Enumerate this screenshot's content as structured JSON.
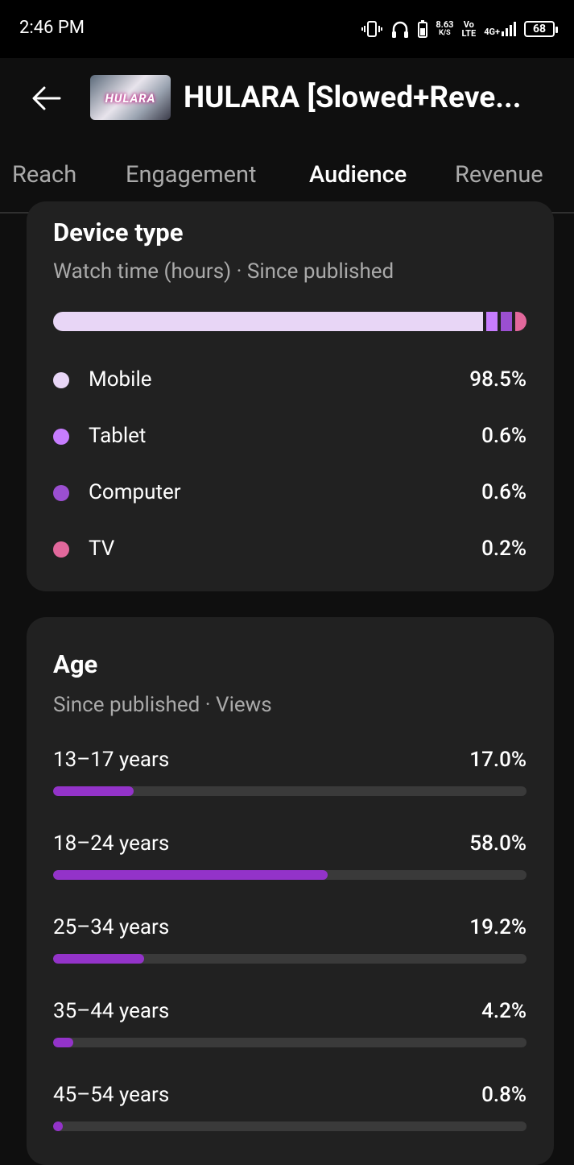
{
  "status_bar": {
    "time": "2:46 PM",
    "net_speed_value": "8.63",
    "net_speed_unit": "K/S",
    "volte_top": "Vo",
    "volte_bottom": "LTE",
    "network": "4G+",
    "battery": "68",
    "icons": [
      "vibrate-icon",
      "headphones-icon",
      "battery-saver-icon",
      "signal-icon",
      "battery-icon"
    ]
  },
  "app_bar": {
    "back_icon": "arrow-left-icon",
    "thumbnail_text": "HULARA",
    "title": "HULARA [Slowed+Reve..."
  },
  "tabs": [
    {
      "label": "Reach",
      "active": false
    },
    {
      "label": "Engagement",
      "active": false
    },
    {
      "label": "Audience",
      "active": true
    },
    {
      "label": "Revenue",
      "active": false
    }
  ],
  "device_type": {
    "title": "Device type",
    "subtitle": "Watch time (hours) · Since published",
    "items": [
      {
        "label": "Mobile",
        "value": "98.5%",
        "percent": 98.5,
        "color": "#e8d6f6"
      },
      {
        "label": "Tablet",
        "value": "0.6%",
        "percent": 0.6,
        "color": "#c77dff"
      },
      {
        "label": "Computer",
        "value": "0.6%",
        "percent": 0.6,
        "color": "#9b4fd1"
      },
      {
        "label": "TV",
        "value": "0.2%",
        "percent": 0.2,
        "color": "#e2689c"
      }
    ]
  },
  "age": {
    "title": "Age",
    "subtitle": "Since published · Views",
    "bar_color": "#9333c9",
    "items": [
      {
        "label": "13–17 years",
        "value": "17.0%",
        "percent": 17.0
      },
      {
        "label": "18–24 years",
        "value": "58.0%",
        "percent": 58.0
      },
      {
        "label": "25–34 years",
        "value": "19.2%",
        "percent": 19.2
      },
      {
        "label": "35–44 years",
        "value": "4.2%",
        "percent": 4.2
      },
      {
        "label": "45–54 years",
        "value": "0.8%",
        "percent": 0.8
      }
    ]
  }
}
